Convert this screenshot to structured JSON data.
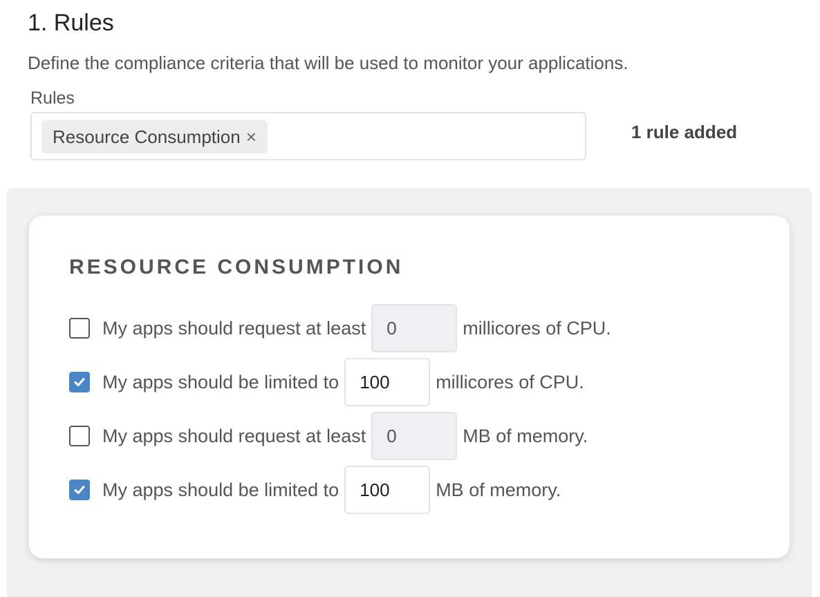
{
  "section": {
    "title": "1. Rules",
    "description": "Define the compliance criteria that will be used to monitor your applications."
  },
  "rules_field": {
    "label": "Rules",
    "tags": [
      {
        "label": "Resource Consumption",
        "remove_glyph": "×"
      }
    ],
    "count_text": "1 rule added"
  },
  "card": {
    "title": "RESOURCE CONSUMPTION",
    "rows": [
      {
        "checked": false,
        "text": "My apps should request at least",
        "value": "0",
        "enabled": false,
        "unit": "millicores of CPU."
      },
      {
        "checked": true,
        "text": "My apps should be limited to",
        "value": "100",
        "enabled": true,
        "unit": "millicores of CPU."
      },
      {
        "checked": false,
        "text": "My apps should request at least",
        "value": "0",
        "enabled": false,
        "unit": "MB of memory."
      },
      {
        "checked": true,
        "text": "My apps should be limited to",
        "value": "100",
        "enabled": true,
        "unit": "MB of memory."
      }
    ]
  },
  "icons": {
    "tag_remove": "close-icon",
    "checkbox_mark": "checkmark-icon"
  },
  "colors": {
    "checkbox_checked": "#4a86c5",
    "panel_background": "#f0f0f0",
    "disabled_input": "#eff0f3"
  }
}
